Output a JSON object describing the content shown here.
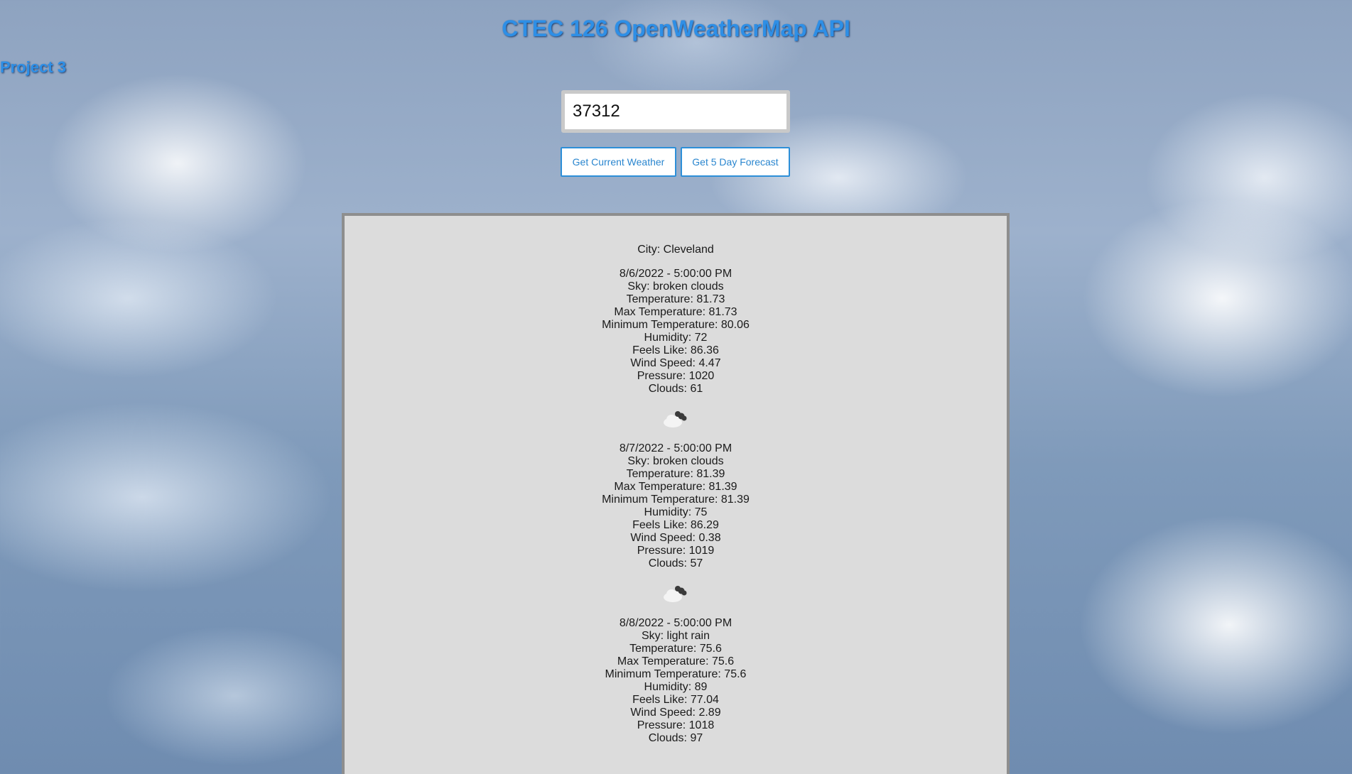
{
  "header": {
    "title": "CTEC 126 OpenWeatherMap API",
    "subtitle": "Project 3"
  },
  "search": {
    "value": "37312"
  },
  "buttons": {
    "current": "Get Current Weather",
    "forecast": "Get 5 Day Forecast"
  },
  "results": {
    "city": "City: Cleveland",
    "days": [
      {
        "datetime": "8/6/2022 - 5:00:00 PM",
        "sky": "Sky: broken clouds",
        "temp": "Temperature: 81.73",
        "max_temp": "Max Temperature: 81.73",
        "min_temp": "Minimum Temperature: 80.06",
        "humidity": "Humidity: 72",
        "feels_like": "Feels Like: 86.36",
        "wind": "Wind Speed: 4.47",
        "pressure": "Pressure: 1020",
        "clouds": "Clouds: 61",
        "icon": "broken-clouds-icon"
      },
      {
        "datetime": "8/7/2022 - 5:00:00 PM",
        "sky": "Sky: broken clouds",
        "temp": "Temperature: 81.39",
        "max_temp": "Max Temperature: 81.39",
        "min_temp": "Minimum Temperature: 81.39",
        "humidity": "Humidity: 75",
        "feels_like": "Feels Like: 86.29",
        "wind": "Wind Speed: 0.38",
        "pressure": "Pressure: 1019",
        "clouds": "Clouds: 57",
        "icon": "broken-clouds-icon"
      },
      {
        "datetime": "8/8/2022 - 5:00:00 PM",
        "sky": "Sky: light rain",
        "temp": "Temperature: 75.6",
        "max_temp": "Max Temperature: 75.6",
        "min_temp": "Minimum Temperature: 75.6",
        "humidity": "Humidity: 89",
        "feels_like": "Feels Like: 77.04",
        "wind": "Wind Speed: 2.89",
        "pressure": "Pressure: 1018",
        "clouds": "Clouds: 97"
      }
    ]
  },
  "colors": {
    "title": "#2e8fe6",
    "button_border": "#2d8fd8",
    "panel_bg": "#dcdcdc",
    "panel_border": "#8e8e8e"
  }
}
